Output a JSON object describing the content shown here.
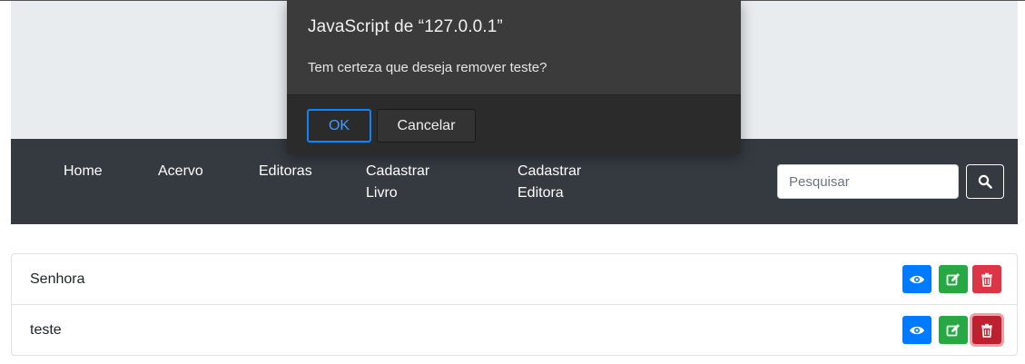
{
  "dialog": {
    "title": "JavaScript de “127.0.0.1”",
    "message": "Tem certeza que deseja remover teste?",
    "ok_label": "OK",
    "cancel_label": "Cancelar"
  },
  "navbar": {
    "items": [
      {
        "label": "Home"
      },
      {
        "label": "Acervo"
      },
      {
        "label": "Editoras"
      },
      {
        "label_line1": "Cadastrar",
        "label_line2": "Livro"
      },
      {
        "label_line1": "Cadastrar",
        "label_line2": "Editora"
      }
    ],
    "search": {
      "placeholder": "Pesquisar",
      "value": "",
      "icon": "search-icon"
    }
  },
  "list": {
    "items": [
      {
        "name": "Senhora",
        "actions": [
          "eye-icon",
          "edit-icon",
          "trash-icon"
        ]
      },
      {
        "name": "teste",
        "actions": [
          "eye-icon",
          "edit-icon",
          "trash-icon"
        ]
      }
    ]
  },
  "colors": {
    "navbar_bg": "#343a40",
    "hero_bg": "#e9ecef",
    "view_button": "#007bff",
    "edit_button": "#28a745",
    "delete_button": "#dc3545",
    "dialog_bg": "#3b3b3b",
    "dialog_accent": "#0a84ff"
  }
}
